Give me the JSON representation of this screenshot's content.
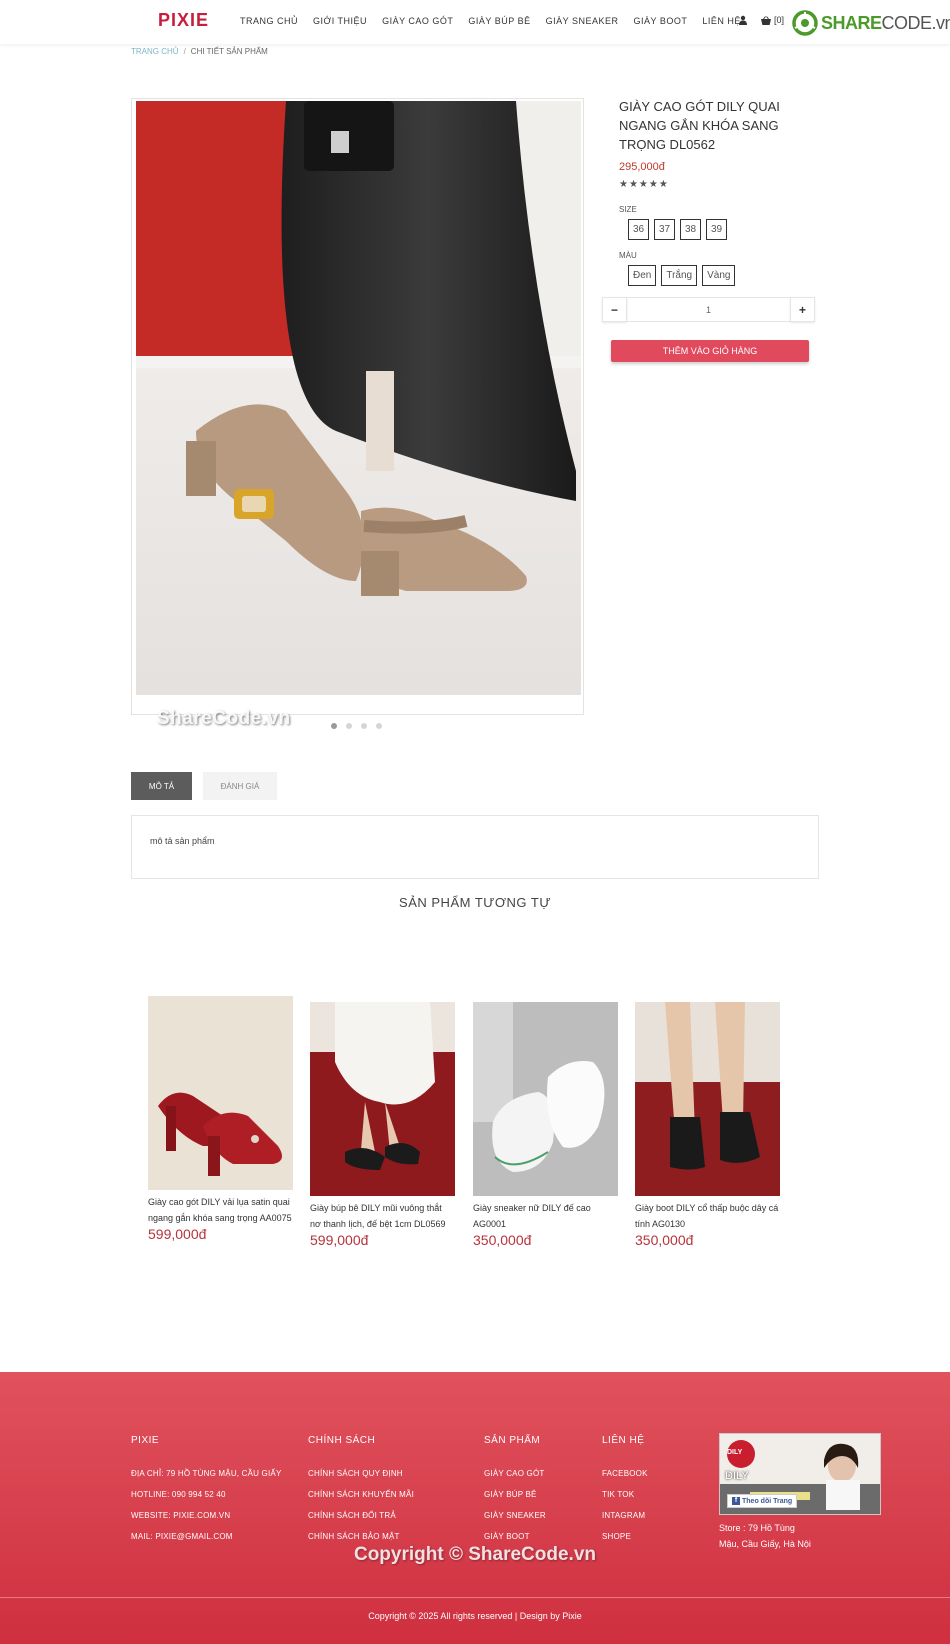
{
  "header": {
    "logo": "PIXIE",
    "nav": [
      "TRANG CHỦ",
      "GIỚI THIỆU",
      "GIÀY CAO GÓT",
      "GIÀY BÚP BÊ",
      "GIÀY SNEAKER",
      "GIÀY BOOT",
      "LIÊN HỆ"
    ],
    "cart_count": "[0]",
    "sharecode_brand": "SHARE",
    "sharecode_suffix": "CODE.vn"
  },
  "breadcrumb": {
    "home": "TRANG CHỦ",
    "separator": "/",
    "current": "CHI TIẾT SẢN PHẨM"
  },
  "product": {
    "title": "GIÀY CAO GÓT DILY QUAI NGANG GẮN KHÓA SANG TRỌNG DL0562",
    "price": "295,000đ",
    "stars": "★★★★★",
    "size_label": "SIZE",
    "sizes": [
      "36",
      "37",
      "38",
      "39"
    ],
    "color_label": "MÀU",
    "colors": [
      "Đen",
      "Trắng",
      "Vàng"
    ],
    "qty_minus": "−",
    "qty_value": "1",
    "qty_plus": "+",
    "add_to_cart": "THÊM VÀO GIỎ HÀNG",
    "slide_count": 4,
    "active_slide": 1
  },
  "watermark_image": "ShareCode.vn",
  "tabs": {
    "description": "MÔ TẢ",
    "reviews": "ĐÁNH GIÁ",
    "content": "mô tả sản phẩm"
  },
  "related": {
    "title": "SẢN PHẨM TƯƠNG TỰ",
    "items": [
      {
        "name": "Giày cao gót DILY vải lụa satin quai ngang gắn khóa sang trọng AA0075",
        "price": "599,000đ"
      },
      {
        "name": "Giày búp bê DILY mũi vuông thắt nơ thanh lịch, đế bệt 1cm DL0569",
        "price": "599,000đ"
      },
      {
        "name": "Giày sneaker nữ DILY đế cao AG0001",
        "price": "350,000đ"
      },
      {
        "name": "Giày boot DILY cổ thấp buộc dây cá tính AG0130",
        "price": "350,000đ"
      }
    ]
  },
  "footer": {
    "col1": {
      "title": "PIXIE",
      "items": [
        "ĐỊA CHỈ: 79 HỒ TÙNG MẬU, CẦU GIẤY",
        "HOTLINE: 090 994 52 40",
        "WEBSITE: PIXIE.COM.VN",
        "MAIL: PIXIE@GMAIL.COM"
      ]
    },
    "col2": {
      "title": "CHÍNH SÁCH",
      "items": [
        "CHÍNH SÁCH QUY ĐỊNH",
        "CHÍNH SÁCH KHUYẾN MÃI",
        "CHÍNH SÁCH ĐỔI TRẢ",
        "CHÍNH SÁCH BẢO MẬT"
      ]
    },
    "col3": {
      "title": "SẢN PHẨM",
      "items": [
        "GIÀY CAO GÓT",
        "GIÀY BÚP BÊ",
        "GIÀY SNEAKER",
        "GIÀY BOOT"
      ]
    },
    "col4": {
      "title": "LIÊN HỆ",
      "items": [
        "FACEBOOK",
        "TIK TOK",
        "INTAGRAM",
        "SHOPE"
      ]
    },
    "fb_badge": "DILY",
    "fb_name": "DILY",
    "fb_follow": "Theo dõi Trang",
    "store_line1": "Store : 79 Hồ Tùng",
    "store_line2": "Mậu, Cầu Giấy, Hà Nội",
    "watermark": "Copyright © ShareCode.vn",
    "copyright": "Copyright © 2025 All rights reserved | Design by Pixie"
  },
  "colors": {
    "brand": "#c81e3a",
    "price": "#c0392b",
    "add_to_cart": "#e04a5c",
    "footer_top": "#e0525d",
    "footer_bottom": "#cf2f3f"
  }
}
